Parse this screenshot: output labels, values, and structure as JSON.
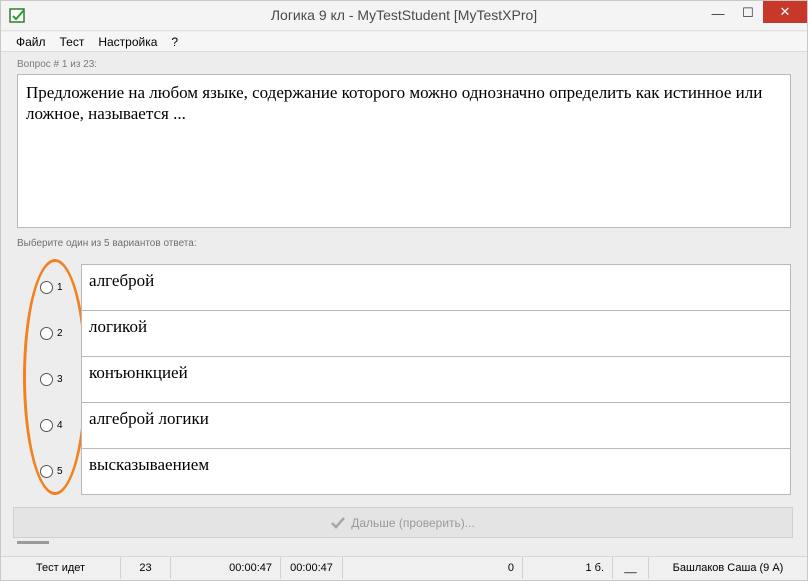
{
  "window": {
    "title": "Логика 9 кл - MyTestStudent [MyTestXPro]",
    "minimize_glyph": "—",
    "maximize_glyph": "☐",
    "close_glyph": "✕",
    "app_icon": "check-box-icon",
    "close_color": "#c7382b"
  },
  "menu": {
    "items": [
      "Файл",
      "Тест",
      "Настройка",
      "?"
    ]
  },
  "question": {
    "label": "Вопрос # 1 из 23:",
    "text": "Предложение на любом языке, содержание которого можно однозначно определить как истинное или ложное, называется ..."
  },
  "answers": {
    "prompt": "Выберите один из 5 вариантов ответа:",
    "options": [
      {
        "num": "1",
        "text": "алгеброй"
      },
      {
        "num": "2",
        "text": "логикой"
      },
      {
        "num": "3",
        "text": "конъюнкцией"
      },
      {
        "num": "4",
        "text": "алгеброй логики"
      },
      {
        "num": "5",
        "text": "высказываением"
      }
    ],
    "highlight_color": "#f1821f"
  },
  "next_button": {
    "label": "Дальше (проверить)...",
    "icon": "check-icon"
  },
  "status": {
    "state": "Тест идет",
    "count": "23",
    "time1": "00:00:47",
    "time2": "00:00:47",
    "score": "0",
    "points": "1 б.",
    "blank": "__",
    "student": "Башлаков Саша (9 А)"
  }
}
